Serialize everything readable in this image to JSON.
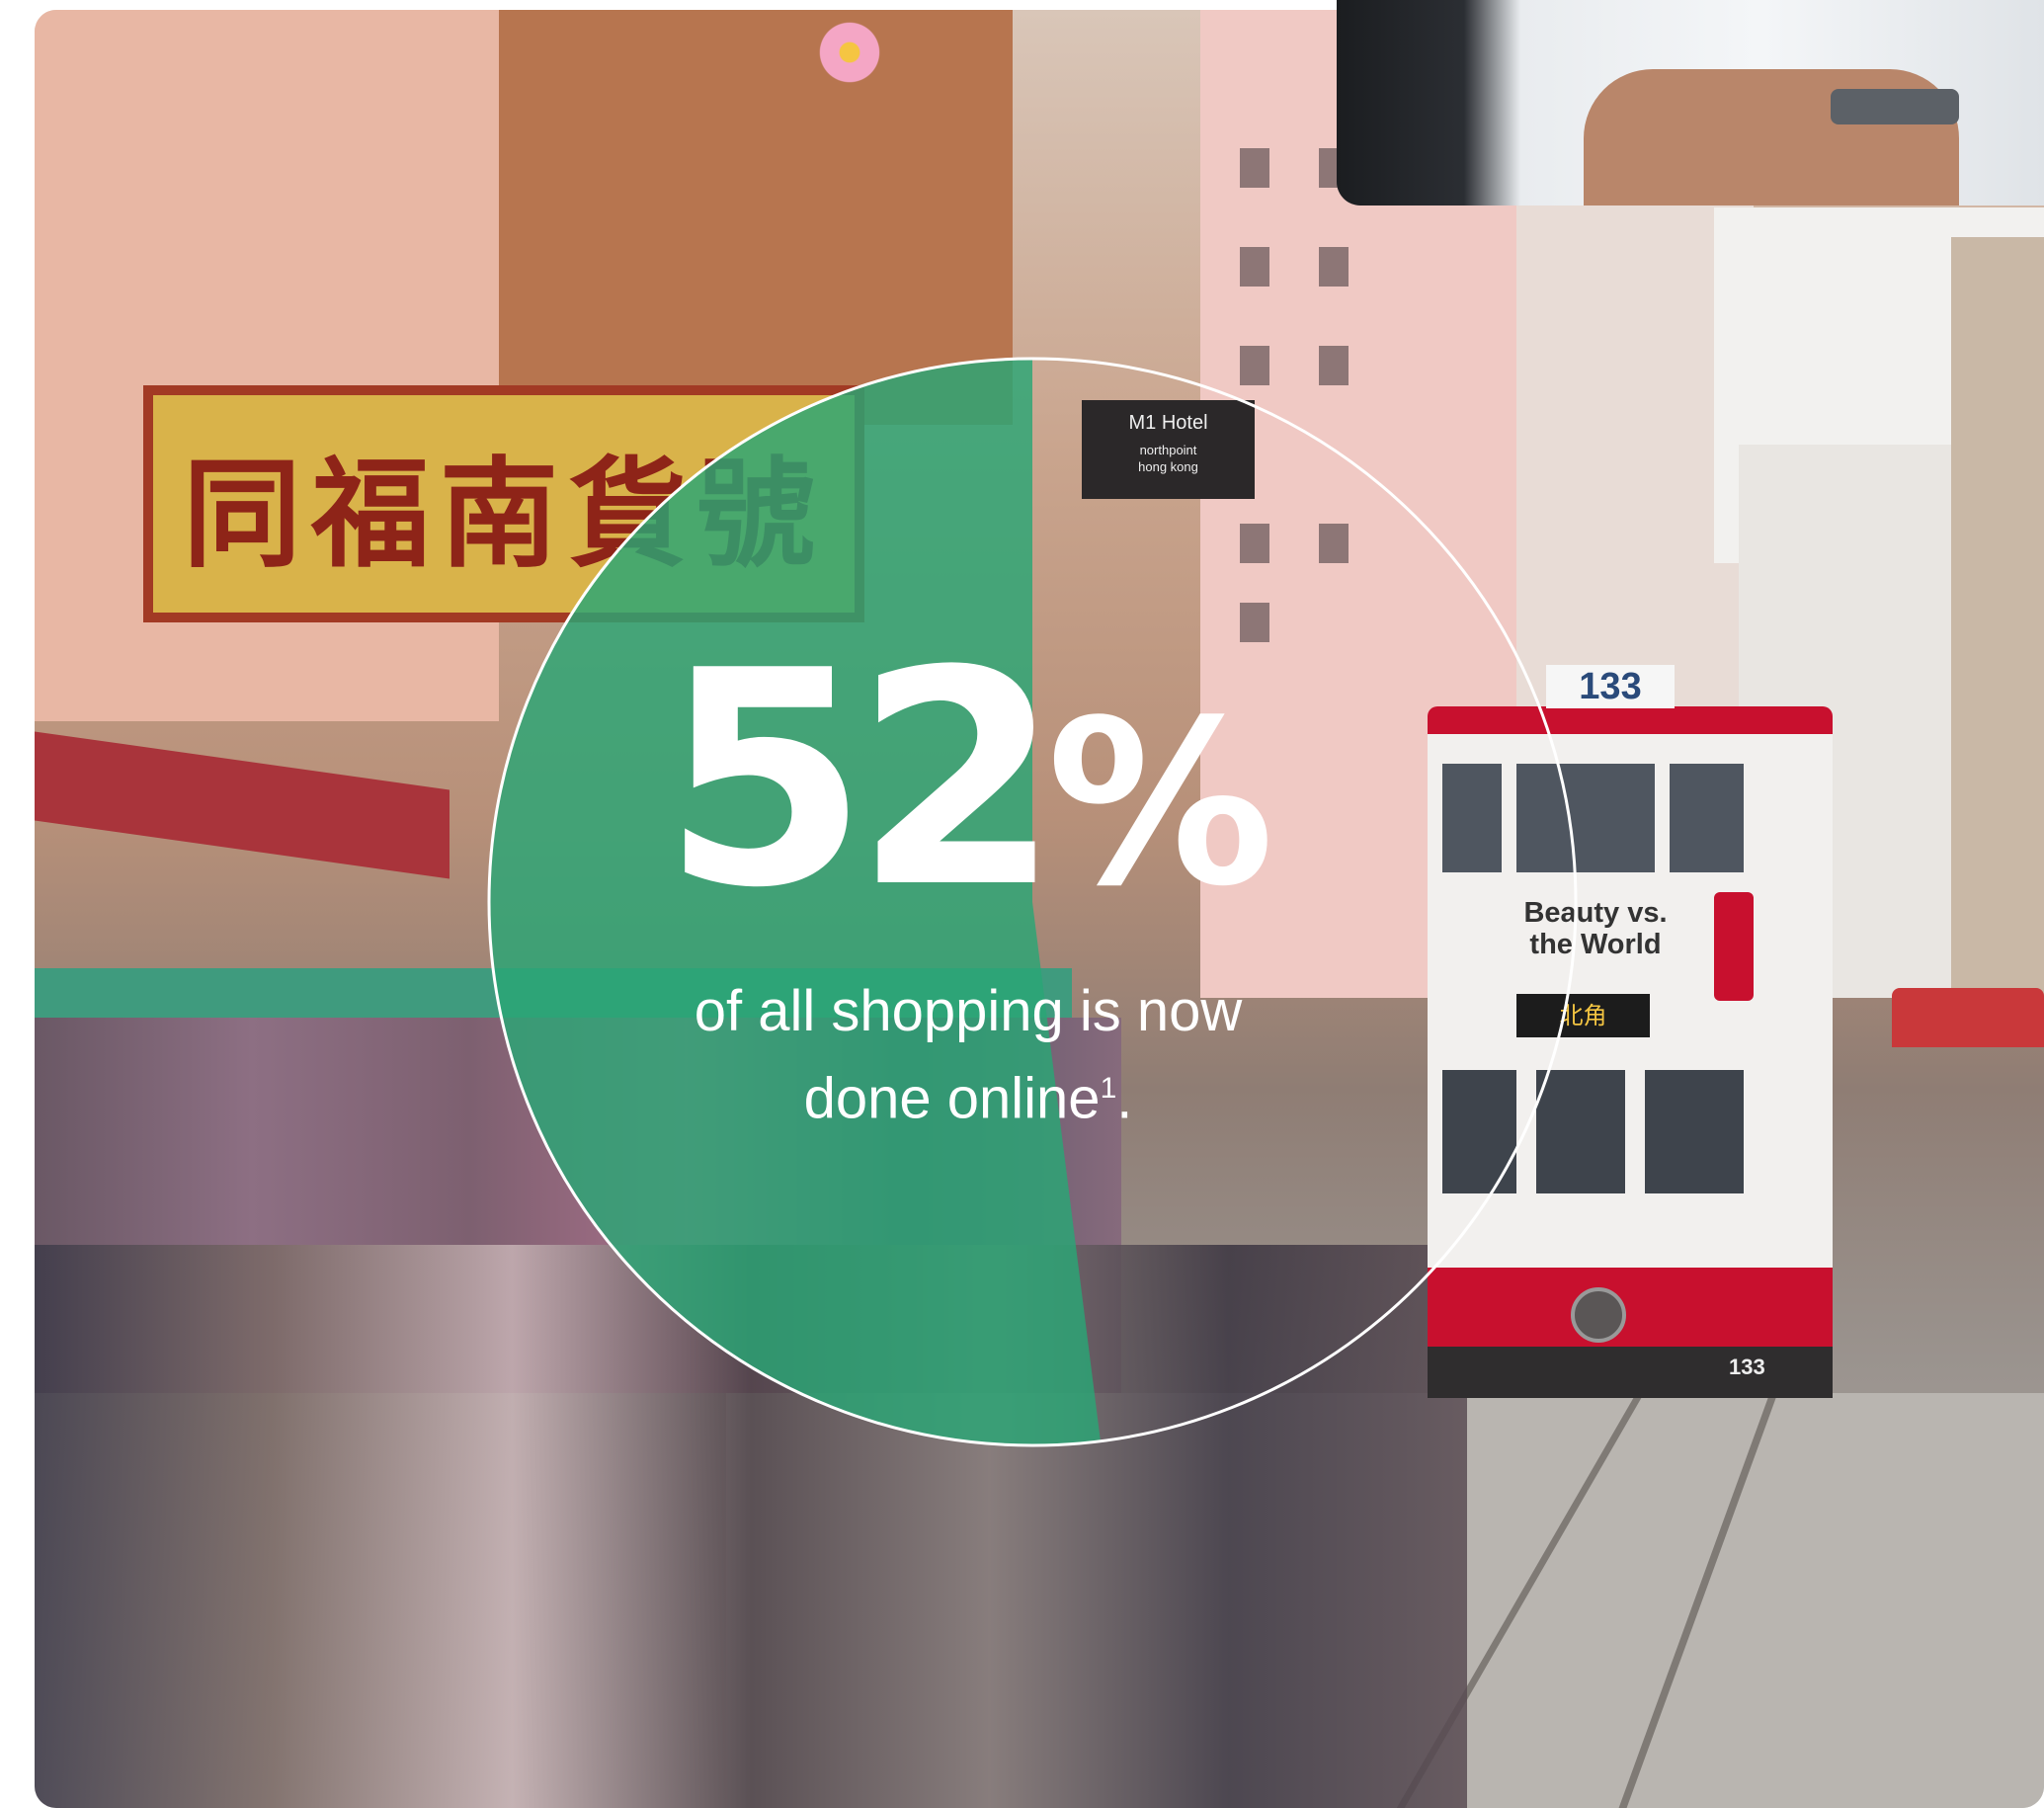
{
  "stat": {
    "value": "52",
    "unit": "%",
    "caption_line1": "of all shopping is now",
    "caption_line2": "done online",
    "footnote_marker": "1",
    "caption_end": "."
  },
  "chart_data": {
    "type": "pie",
    "values": [
      52
    ],
    "range": [
      0,
      100
    ],
    "fill_color": "#2aa675",
    "outline_color": "#ffffff"
  },
  "photo": {
    "shop_sign": "同福南貨號",
    "hotel_sign_line1": "M1 Hotel",
    "hotel_sign_line2": "northpoint",
    "hotel_sign_line3": "hong kong",
    "tram_route": "133",
    "tram_ad_line1": "Beauty vs.",
    "tram_ad_line2": "the World",
    "tram_destination": "北角",
    "tram_fleet_number": "133"
  },
  "colors": {
    "accent_green": "#2aa675",
    "tram_red": "#c8102e",
    "tram_white": "#f2f0ee"
  }
}
